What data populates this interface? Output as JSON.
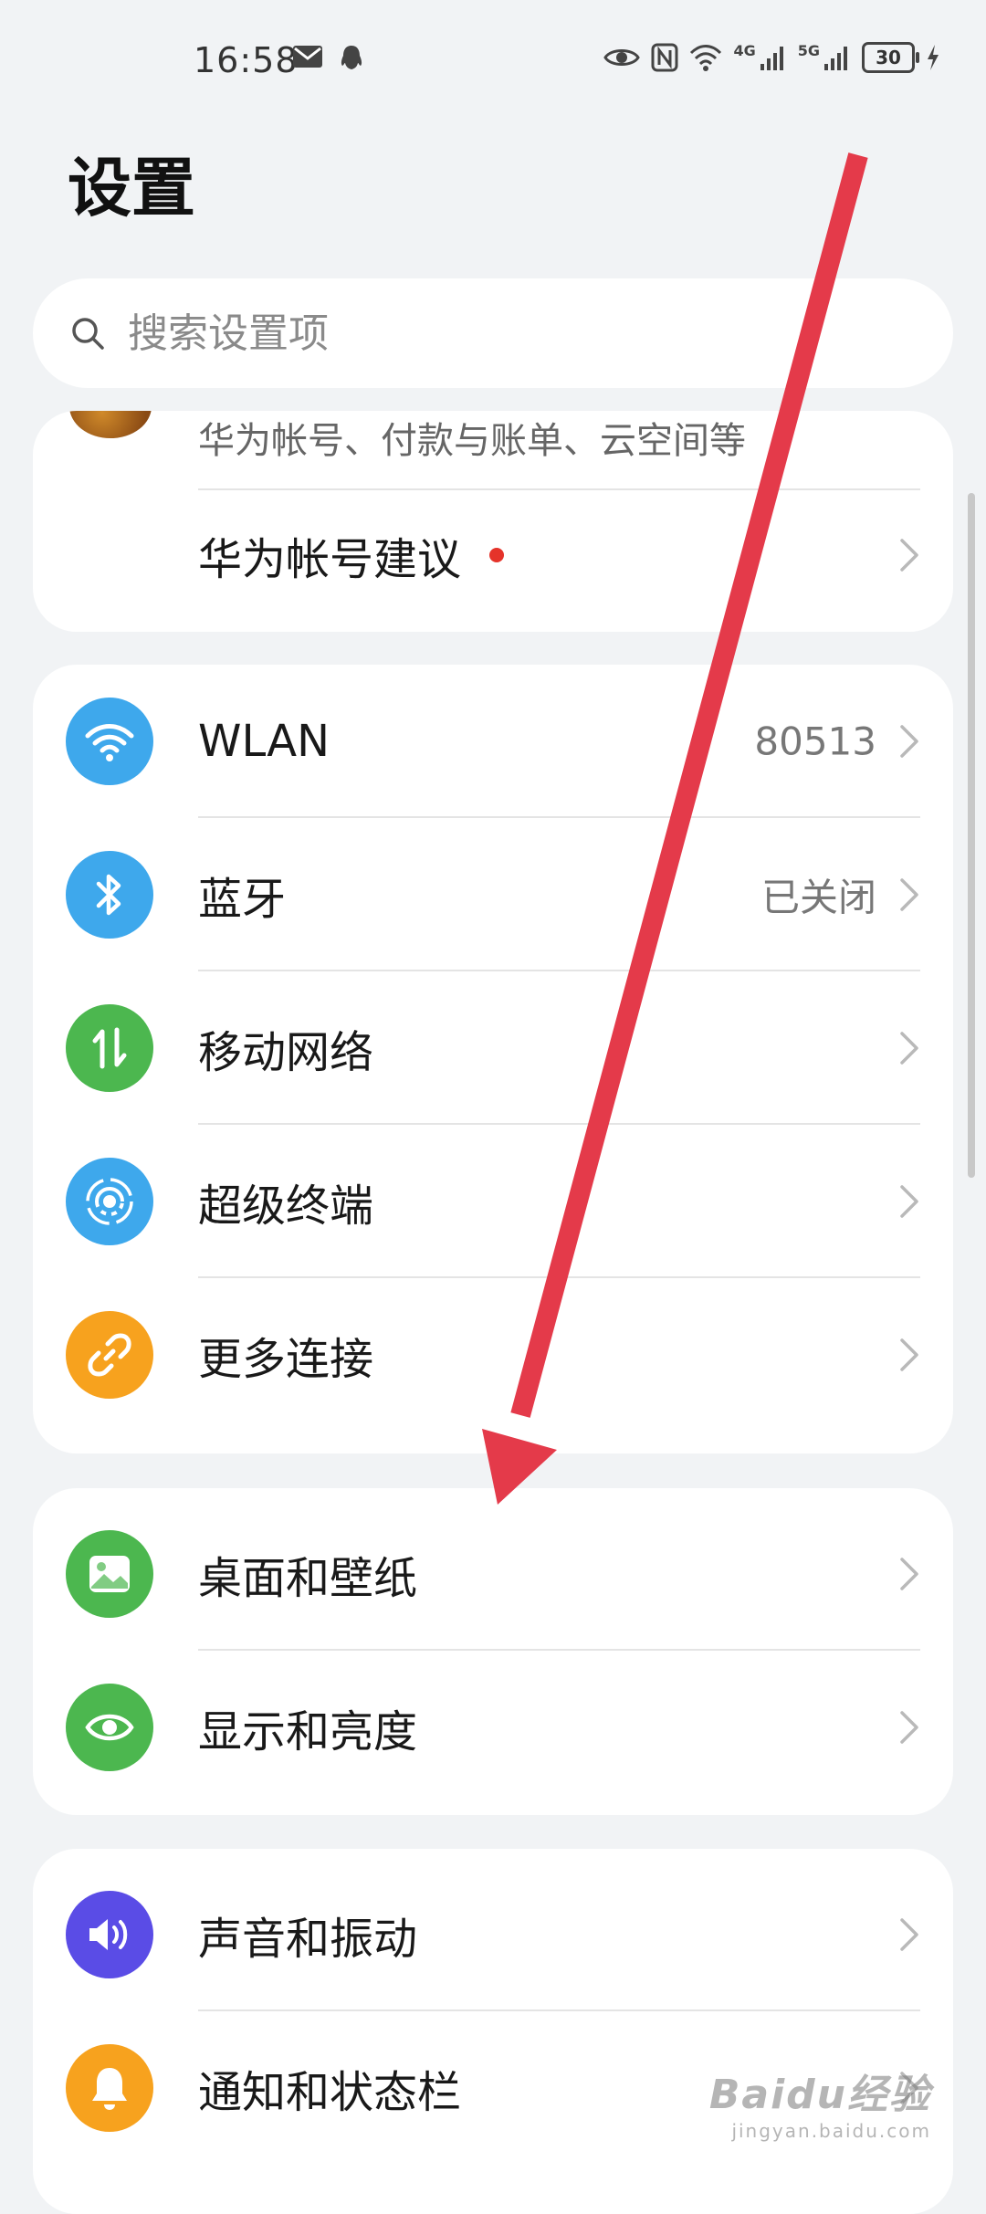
{
  "status_bar": {
    "time": "16:58",
    "network_4g": "4G",
    "network_5g": "5G",
    "battery": "30"
  },
  "page": {
    "title": "设置"
  },
  "search": {
    "placeholder": "搜索设置项"
  },
  "account_card": {
    "subtitle": "华为帐号、付款与账单、云空间等",
    "suggestion_label": "华为帐号建议"
  },
  "connectivity": [
    {
      "label": "WLAN",
      "value": "80513",
      "icon": "wifi-icon",
      "color": "#3ea8ec"
    },
    {
      "label": "蓝牙",
      "value": "已关闭",
      "icon": "bluetooth-icon",
      "color": "#3ea8ec"
    },
    {
      "label": "移动网络",
      "value": "",
      "icon": "mobile-data-icon",
      "color": "#4cb74f"
    },
    {
      "label": "超级终端",
      "value": "",
      "icon": "super-device-icon",
      "color": "#3ea8ec"
    },
    {
      "label": "更多连接",
      "value": "",
      "icon": "link-icon",
      "color": "#f7a21e"
    }
  ],
  "display": [
    {
      "label": "桌面和壁纸",
      "icon": "wallpaper-icon",
      "color": "#4cb74f"
    },
    {
      "label": "显示和亮度",
      "icon": "eye-icon",
      "color": "#4cb74f"
    }
  ],
  "sound": [
    {
      "label": "声音和振动",
      "icon": "speaker-icon",
      "color": "#5a4ce6"
    },
    {
      "label": "通知和状态栏",
      "icon": "bell-icon",
      "color": "#f7a21e"
    }
  ],
  "annotation": {
    "color": "#e43a4a"
  },
  "watermark": {
    "main": "Baidu经验",
    "sub": "jingyan.baidu.com"
  }
}
